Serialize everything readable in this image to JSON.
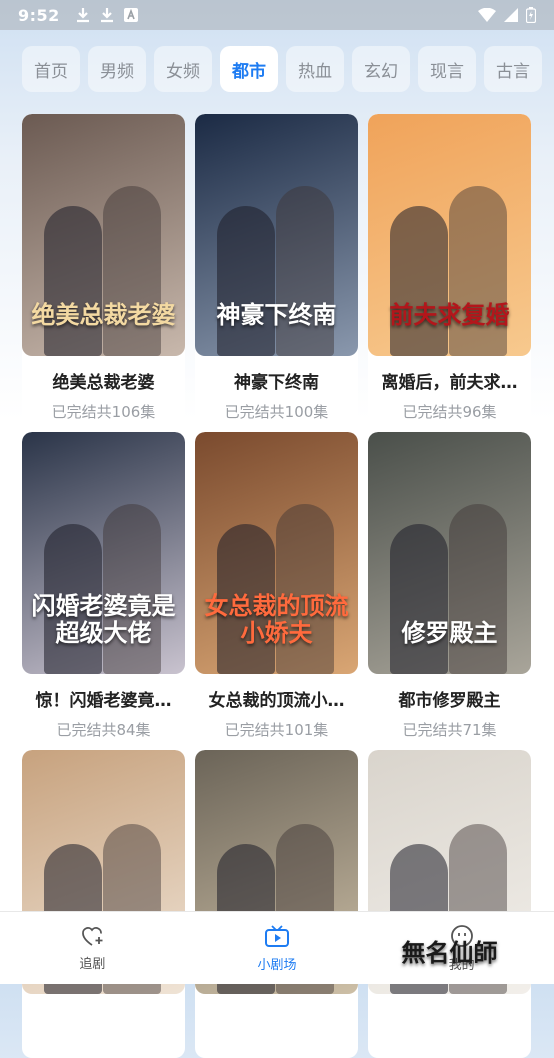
{
  "status_bar": {
    "time": "9:52"
  },
  "tabs": [
    {
      "label": "首页",
      "active": false
    },
    {
      "label": "男频",
      "active": false
    },
    {
      "label": "女频",
      "active": false
    },
    {
      "label": "都市",
      "active": true
    },
    {
      "label": "热血",
      "active": false
    },
    {
      "label": "玄幻",
      "active": false
    },
    {
      "label": "现言",
      "active": false
    },
    {
      "label": "古言",
      "active": false
    }
  ],
  "dramas": [
    {
      "title": "绝美总裁老婆",
      "status": "已完结共106集",
      "poster_text": "绝美总裁老婆",
      "colors": [
        "#6b5a52",
        "#c8b8ac"
      ],
      "text_color": "#f3d9a2"
    },
    {
      "title": "神豪下终南",
      "status": "已完结共100集",
      "poster_text": "神豪下终南",
      "colors": [
        "#1b2a44",
        "#8a98ad"
      ],
      "text_color": "#ffffff"
    },
    {
      "title": "离婚后，前夫求…",
      "status": "已完结共96集",
      "poster_text": "前夫求复婚",
      "colors": [
        "#f0a35a",
        "#f7c98e"
      ],
      "text_color": "#b3161b"
    },
    {
      "title": "惊！闪婚老婆竟…",
      "status": "已完结共84集",
      "poster_text": "闪婚老婆竟是超级大佬",
      "colors": [
        "#2a3448",
        "#c9c3cf"
      ],
      "text_color": "#ffffff"
    },
    {
      "title": "女总裁的顶流小…",
      "status": "已完结共101集",
      "poster_text": "女总裁的顶流小娇夫",
      "colors": [
        "#7a4a2e",
        "#d9a674"
      ],
      "text_color": "#ff6a3d"
    },
    {
      "title": "都市修罗殿主",
      "status": "已完结共71集",
      "poster_text": "修罗殿主",
      "colors": [
        "#4a4f4a",
        "#a9a59a"
      ],
      "text_color": "#ffffff"
    },
    {
      "title": "",
      "status": "",
      "poster_text": "",
      "colors": [
        "#c7a27e",
        "#efe3d5"
      ],
      "text_color": "#ffffff"
    },
    {
      "title": "",
      "status": "",
      "poster_text": "",
      "colors": [
        "#6b6458",
        "#cdbfa6"
      ],
      "text_color": "#ffffff"
    },
    {
      "title": "",
      "status": "",
      "poster_text": "無名仙師",
      "colors": [
        "#d9d4cc",
        "#f2efea"
      ],
      "text_color": "#1a1a1a"
    }
  ],
  "bottom_nav": [
    {
      "label": "追剧",
      "icon": "heart-plus-icon",
      "active": false
    },
    {
      "label": "小剧场",
      "icon": "tv-play-icon",
      "active": true
    },
    {
      "label": "我的",
      "icon": "smile-face-icon",
      "active": false
    }
  ]
}
